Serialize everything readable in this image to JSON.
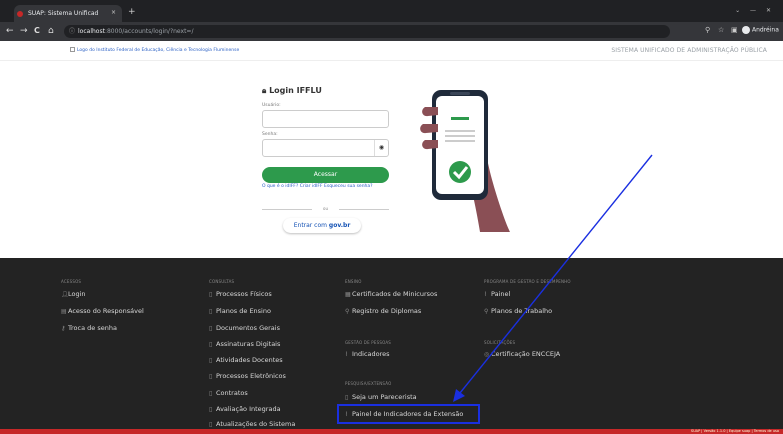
{
  "browser": {
    "tab_title": "SUAP: Sistema Unificad",
    "tab_close": "×",
    "new_tab": "+",
    "window_controls": "⌄ — ✕",
    "back": "←",
    "forward": "→",
    "reload": "C",
    "home": "⌂",
    "url_host": "localhost",
    "url_path": ":8000/accounts/login/?next=/",
    "profile_name": "Andréina"
  },
  "header": {
    "logo_alt": "Logo do Instituto Federal de Educação, Ciência e Tecnologia Fluminense",
    "system_name": "SISTEMA UNIFICADO DE ADMINISTRAÇÃO PÚBLICA"
  },
  "login": {
    "title": "Login IFFLU",
    "username_label": "Usuário:",
    "password_label": "Senha:",
    "submit_label": "Acessar",
    "help_text": "O que é o idIFF? Criar idIFF Esqueceu sua senha?",
    "or_text": "ou",
    "govbr_prefix": "Entrar com ",
    "govbr_brand": "gov.br"
  },
  "footer": {
    "columns": [
      {
        "heading": "ACESSOS",
        "items": [
          "Login",
          "Acesso do Responsável",
          "Troca de senha"
        ]
      },
      {
        "heading": "CONSULTAS",
        "items": [
          "Processos Físicos",
          "Planos de Ensino",
          "Documentos Gerais",
          "Assinaturas Digitais",
          "Atividades Docentes",
          "Processos Eletrônicos",
          "Contratos",
          "Avaliação Integrada",
          "Atualizações do Sistema"
        ]
      },
      {
        "heading": "ENSINO",
        "items": [
          "Certificados de Minicursos",
          "Registro de Diplomas"
        ]
      },
      {
        "heading": "GESTÃO DE PESSOAS",
        "items": [
          "Indicadores"
        ]
      },
      {
        "heading": "PESQUISA/EXTENSÃO",
        "items": [
          "Seja um Parecerista",
          "Painel de Indicadores da Extensão"
        ]
      },
      {
        "heading": "PROGRAMA DE GESTÃO E DESEMPENHO",
        "items": [
          "Painel",
          "Planos de Trabalho"
        ]
      },
      {
        "heading": "SOLICITAÇÕES",
        "items": [
          "Certificação ENCCEJA"
        ]
      }
    ],
    "bottom_text": "SUAP | Versão 1.1.0 | Equipe suap | Termos de uso"
  },
  "colors": {
    "primary_green": "#2d9a4c",
    "annotation_blue": "#1a2fe0",
    "footer_bg": "#232323",
    "bottom_bar": "#c62828"
  }
}
